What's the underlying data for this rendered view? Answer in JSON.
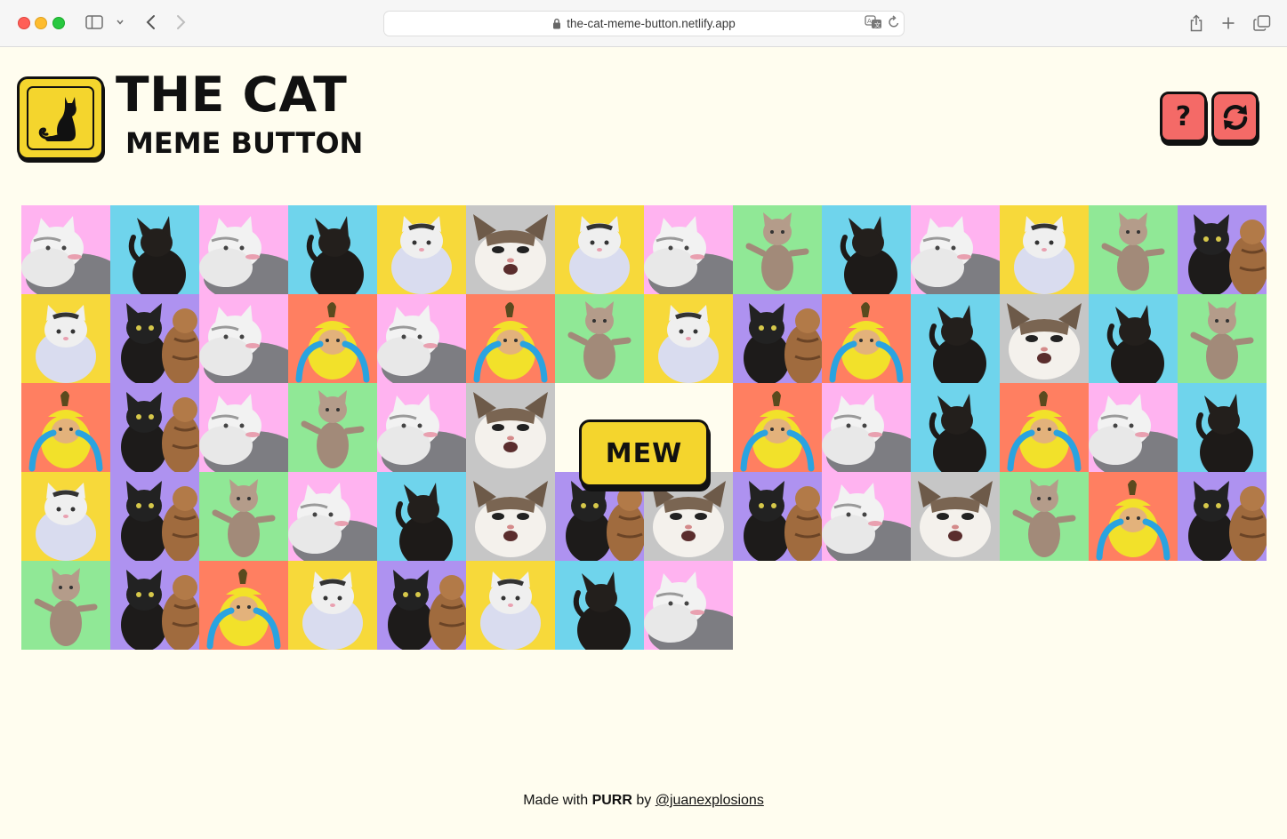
{
  "browser": {
    "url": "the-cat-meme-button.netlify.app"
  },
  "header": {
    "title_line1": "THE CAT",
    "title_line2": "MEME BUTTON",
    "help_label": "?"
  },
  "main": {
    "button_label": "MEW",
    "tile_icon": "cat-meme-image",
    "tiles": [
      "w",
      "k",
      "w",
      "k",
      "p",
      "s",
      "p",
      "w",
      "d",
      "k",
      "w",
      "p",
      "d",
      "b",
      "p",
      "b",
      "w",
      "n",
      "w",
      "n",
      "d",
      "p",
      "b",
      "n",
      "k",
      "s",
      "k",
      "d",
      "n",
      "b",
      "w",
      "d",
      "w",
      "s",
      "x",
      "x",
      "n",
      "w",
      "k",
      "n",
      "w",
      "k",
      "p",
      "b",
      "d",
      "w",
      "k",
      "s",
      "b",
      "s",
      "b",
      "w",
      "s",
      "d",
      "n",
      "b",
      "d",
      "b",
      "n",
      "p",
      "b",
      "p",
      "k",
      "w"
    ],
    "tile_kinds": {
      "w": {
        "name": "white-cat",
        "bg": "#ffb3f0"
      },
      "k": {
        "name": "black-cat-back",
        "bg": "#6fd4ec"
      },
      "p": {
        "name": "plump-white-cat",
        "bg": "#f7d93a"
      },
      "s": {
        "name": "screaming-cat",
        "bg": "#c6c6c6"
      },
      "d": {
        "name": "dancing-cat",
        "bg": "#90e896"
      },
      "b": {
        "name": "black-and-tabby-cats",
        "bg": "#ae92f0"
      },
      "n": {
        "name": "banana-cat",
        "bg": "#ff7f61"
      }
    }
  },
  "footer": {
    "prefix": "Made with",
    "brand": "PURR",
    "by": "by",
    "author": "@juanexplosions"
  }
}
